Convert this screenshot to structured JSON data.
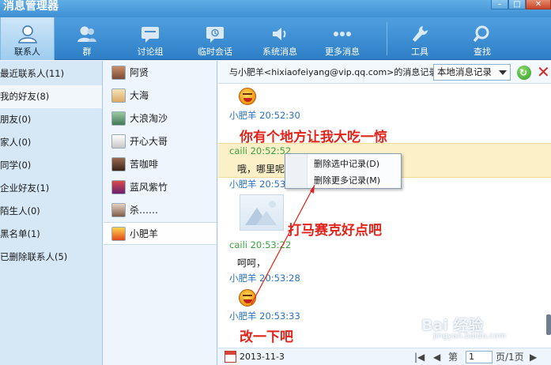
{
  "window": {
    "title": "消息管理器"
  },
  "toolbar": [
    {
      "label": "联系人",
      "icon": "contact-icon",
      "active": true
    },
    {
      "label": "群",
      "icon": "group-icon"
    },
    {
      "label": "讨论组",
      "icon": "discussion-icon"
    },
    {
      "label": "临时会话",
      "icon": "temp-chat-icon"
    },
    {
      "label": "系统消息",
      "icon": "speaker-icon"
    },
    {
      "label": "更多消息",
      "icon": "more-dots-icon"
    },
    {
      "label": "工具",
      "icon": "wrench-icon"
    },
    {
      "label": "查找",
      "icon": "search-icon"
    }
  ],
  "categories": [
    {
      "label": "最近联系人(11)"
    },
    {
      "label": "我的好友(8)",
      "selected": true
    },
    {
      "label": "朋友(0)"
    },
    {
      "label": "家人(0)"
    },
    {
      "label": "同学(0)"
    },
    {
      "label": "企业好友(1)"
    },
    {
      "label": "陌生人(0)"
    },
    {
      "label": "黑名单(1)"
    },
    {
      "label": "已删除联系人(5)"
    }
  ],
  "friends": [
    {
      "name": "阿贤"
    },
    {
      "name": "大海"
    },
    {
      "name": "大浪淘沙"
    },
    {
      "name": "开心大哥"
    },
    {
      "name": "苦咖啡"
    },
    {
      "name": "蓝风紫竹"
    },
    {
      "name": "杀……"
    },
    {
      "name": "小肥羊",
      "selected": true
    }
  ],
  "message_header": {
    "text": "与小肥羊<hixiaofeiyang@vip.qq.com>的消息记录",
    "source_select": "本地消息记录"
  },
  "messages": {
    "m1_sender": "小肥羊 20:52:30",
    "m2_sender": "caili 20:52:52",
    "m2_text": "哦，哪里呢",
    "m3_sender": "小肥羊 20:53",
    "m4_sender": "caili 20:53:22",
    "m4_text": "呵呵，",
    "m5_sender": "小肥羊 20:53:28",
    "m6_sender": "小肥羊 20:53:33"
  },
  "annotations": {
    "a1": "你有个地方让我大吃一惊",
    "a2": "打马赛克好点吧",
    "a3": "改一下吧"
  },
  "context_menu": {
    "delete_selected": "删除选中记录(D)",
    "delete_more": "删除更多记录(M)"
  },
  "footer": {
    "date": "2013-11-3",
    "page_prefix": "第",
    "page_value": "1",
    "page_suffix": "页/1页"
  },
  "watermark": {
    "brand": "Bai 经验",
    "url": "jingyan.baidu.com"
  },
  "colors": {
    "toolbar_blue": "#3f8fd4",
    "sender_them": "#2a72c0",
    "sender_me": "#3aa040",
    "annotation_red": "#e2231a",
    "highlight": "#fbf0c8"
  }
}
